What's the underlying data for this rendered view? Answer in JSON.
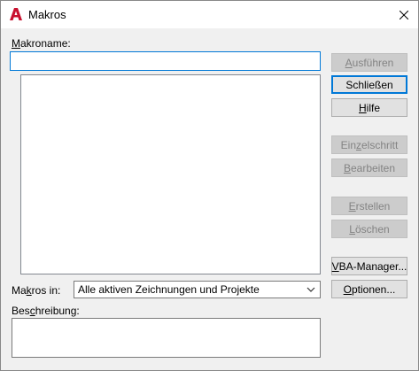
{
  "window": {
    "title": "Makros",
    "icon": "autocad-a-icon",
    "accent_color": "#0078d7"
  },
  "macro_name": {
    "label_accel": "M",
    "label_rest": "akroname:",
    "value": ""
  },
  "macro_list": {
    "items": []
  },
  "buttons": {
    "run": {
      "accel": "A",
      "rest": "usführen",
      "enabled": false
    },
    "close": {
      "label": "Schließen",
      "enabled": true
    },
    "help": {
      "accel": "H",
      "rest": "ilfe",
      "enabled": true
    },
    "step_into": {
      "pre": "Ein",
      "accel": "z",
      "post": "elschritt",
      "enabled": false
    },
    "edit": {
      "accel": "B",
      "rest": "earbeiten",
      "enabled": false
    },
    "create": {
      "accel": "E",
      "rest": "rstellen",
      "enabled": false
    },
    "delete": {
      "accel": "L",
      "rest": "öschen",
      "enabled": false
    },
    "vba_manager": {
      "accel": "V",
      "rest": "BA-Manager...",
      "enabled": true
    },
    "options": {
      "accel": "O",
      "rest": "ptionen...",
      "enabled": true
    }
  },
  "macros_in": {
    "label_pre": "Ma",
    "label_accel": "k",
    "label_post": "ros in:",
    "selected": "Alle aktiven Zeichnungen und Projekte"
  },
  "description": {
    "label_pre": "Bes",
    "label_accel": "c",
    "label_post": "hreibung:",
    "value": ""
  }
}
